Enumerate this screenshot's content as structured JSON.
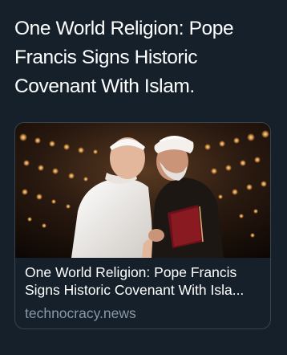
{
  "tweet": {
    "text": "One World Religion: Pope Francis Signs Historic Covenant With Islam."
  },
  "card": {
    "title_line1": "One World Religion: Pope Francis",
    "title_line2": "Signs Historic Covenant With Isla...",
    "domain": "technocracy.news",
    "image": "photo-two-clerics-embracing"
  },
  "colors": {
    "background": "#15202b",
    "text": "#ffffff",
    "secondary_text": "#8899a6",
    "card_border": "#38444d"
  }
}
